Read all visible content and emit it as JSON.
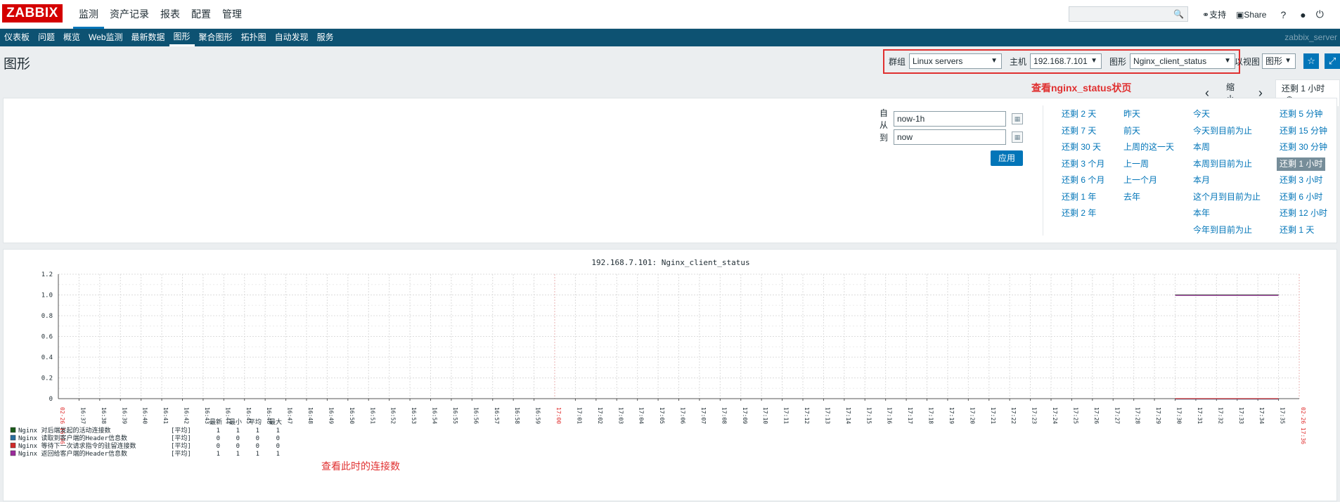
{
  "topbar": {
    "logo": "ZABBIX",
    "menu": [
      "监测",
      "资产记录",
      "报表",
      "配置",
      "管理"
    ],
    "links": {
      "support": "支持",
      "share": "Share",
      "help": "?"
    }
  },
  "subnav": {
    "items": [
      "仪表板",
      "问题",
      "概览",
      "Web监测",
      "最新数据",
      "图形",
      "聚合图形",
      "拓扑图",
      "自动发现",
      "服务"
    ],
    "server": "zabbix_server"
  },
  "header": {
    "title": "图形",
    "group_label": "群组",
    "group_value": "Linux servers",
    "host_label": "主机",
    "host_value": "192.168.7.101",
    "graph_label": "图形",
    "graph_value": "Nginx_client_status",
    "view_label": "以视图",
    "view_value": "图形"
  },
  "timebar": {
    "annotation": "查看nginx_status状页",
    "zoom_out": "缩小",
    "active_tab": "还剩 1 小时"
  },
  "filter": {
    "from_label": "自从",
    "from_value": "now-1h",
    "to_label": "到",
    "to_value": "now",
    "apply": "应用",
    "quick": [
      [
        "还剩 2 天",
        "还剩 7 天",
        "还剩 30 天",
        "还剩 3 个月",
        "还剩 6 个月",
        "还剩 1 年",
        "还剩 2 年"
      ],
      [
        "昨天",
        "前天",
        "上周的这一天",
        "上一周",
        "上一个月",
        "去年"
      ],
      [
        "今天",
        "今天到目前为止",
        "本周",
        "本周到目前为止",
        "本月",
        "这个月到目前为止",
        "本年",
        "今年到目前为止"
      ],
      [
        "还剩 5 分钟",
        "还剩 15 分钟",
        "还剩 30 分钟",
        "还剩 1 小时",
        "还剩 3 小时",
        "还剩 6 小时",
        "还剩 12 小时",
        "还剩 1 天"
      ]
    ]
  },
  "graph": {
    "title": "192.168.7.101: Nginx_client_status",
    "annotation": "查看此时的连接数",
    "legend_headers": [
      "最新",
      "最小",
      "平均",
      "最大"
    ],
    "legend_func": "[平均]"
  },
  "chart_data": {
    "type": "line",
    "title": "192.168.7.101: Nginx_client_status",
    "ylim": [
      0,
      1.2
    ],
    "yticks": [
      "0",
      "0.2",
      "0.4",
      "0.6",
      "0.8",
      "1.0",
      "1.2"
    ],
    "x_start_label": "02-26 16:36",
    "x_mid_label": "17:00",
    "x_end_label": "02-26 17:36",
    "x_ticks": [
      "16:37",
      "16:38",
      "16:39",
      "16:40",
      "16:41",
      "16:42",
      "16:43",
      "16:44",
      "16:45",
      "16:46",
      "16:47",
      "16:48",
      "16:49",
      "16:50",
      "16:51",
      "16:52",
      "16:53",
      "16:54",
      "16:55",
      "16:56",
      "16:57",
      "16:58",
      "16:59",
      "17:01",
      "17:02",
      "17:03",
      "17:04",
      "17:05",
      "17:06",
      "17:07",
      "17:08",
      "17:09",
      "17:10",
      "17:11",
      "17:12",
      "17:13",
      "17:14",
      "17:15",
      "17:16",
      "17:17",
      "17:18",
      "17:19",
      "17:20",
      "17:21",
      "17:22",
      "17:23",
      "17:24",
      "17:25",
      "17:26",
      "17:27",
      "17:28",
      "17:29",
      "17:30",
      "17:31",
      "17:32",
      "17:33",
      "17:34",
      "17:35"
    ],
    "series": [
      {
        "name": "Nginx 对后端发起的活动连接数",
        "color": "#1a5c1a",
        "x_range": [
          "17:30",
          "17:35"
        ],
        "value": 1,
        "stats": [
          "1",
          "1",
          "1",
          "1"
        ]
      },
      {
        "name": "Nginx 读取到客户端的Header信息数",
        "color": "#2a6e9e",
        "x_range": [
          "17:30",
          "17:35"
        ],
        "value": 0,
        "stats": [
          "0",
          "0",
          "0",
          "0"
        ]
      },
      {
        "name": "Nginx 等待下一次请求指令的驻留连接数",
        "color": "#d12a2a",
        "x_range": [
          "17:30",
          "17:35"
        ],
        "value": 0,
        "stats": [
          "0",
          "0",
          "0",
          "0"
        ]
      },
      {
        "name": "Nginx 返回给客户端的Header信息数",
        "color": "#9c2a9c",
        "x_range": [
          "17:30",
          "17:35"
        ],
        "value": 1,
        "stats": [
          "1",
          "1",
          "1",
          "1"
        ]
      }
    ]
  }
}
